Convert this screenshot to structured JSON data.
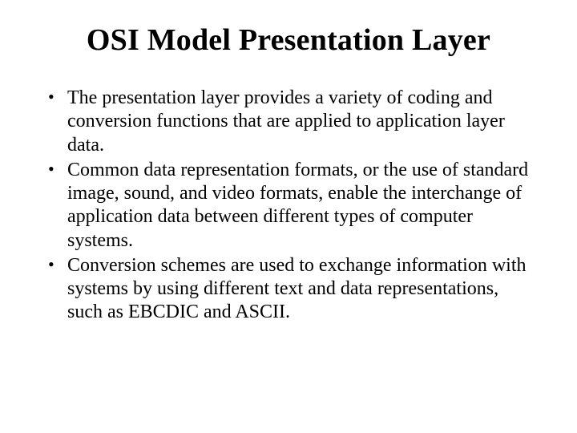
{
  "title": "OSI Model Presentation Layer",
  "bullets": [
    "The presentation layer provides a variety of coding and conversion functions that are applied to application layer data.",
    "Common data representation formats, or the use of standard image, sound, and video formats, enable the interchange of application data between different types of computer systems.",
    "Conversion schemes are used to exchange information with systems by using different text and data representations, such as EBCDIC and ASCII."
  ]
}
